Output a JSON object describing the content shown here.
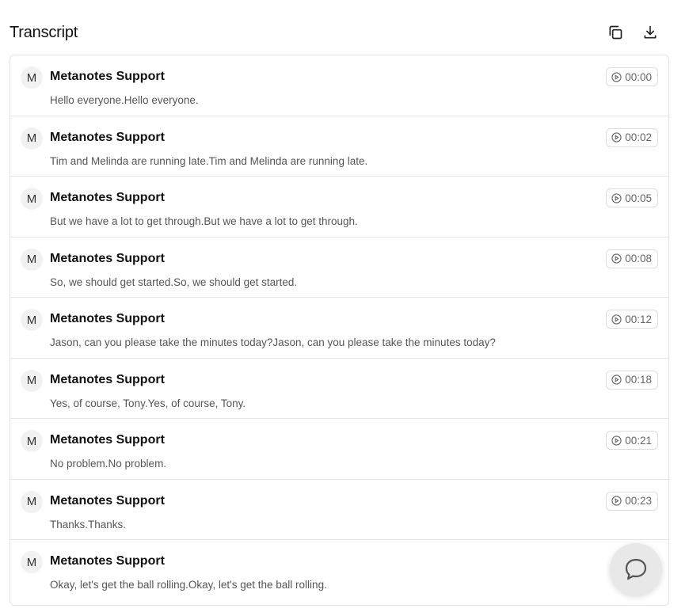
{
  "header": {
    "title": "Transcript",
    "copy_icon": "copy-icon",
    "download_icon": "download-icon"
  },
  "entries": [
    {
      "avatar": "M",
      "speaker": "Metanotes Support",
      "time": "00:00",
      "text": "Hello everyone.Hello everyone."
    },
    {
      "avatar": "M",
      "speaker": "Metanotes Support",
      "time": "00:02",
      "text": "Tim and Melinda are running late.Tim and Melinda are running late."
    },
    {
      "avatar": "M",
      "speaker": "Metanotes Support",
      "time": "00:05",
      "text": "But we have a lot to get through.But we have a lot to get through."
    },
    {
      "avatar": "M",
      "speaker": "Metanotes Support",
      "time": "00:08",
      "text": "So, we should get started.So, we should get started."
    },
    {
      "avatar": "M",
      "speaker": "Metanotes Support",
      "time": "00:12",
      "text": "Jason, can you please take the minutes today?Jason, can you please take the minutes today?"
    },
    {
      "avatar": "M",
      "speaker": "Metanotes Support",
      "time": "00:18",
      "text": "Yes, of course, Tony.Yes, of course, Tony."
    },
    {
      "avatar": "M",
      "speaker": "Metanotes Support",
      "time": "00:21",
      "text": "No problem.No problem."
    },
    {
      "avatar": "M",
      "speaker": "Metanotes Support",
      "time": "00:23",
      "text": "Thanks.Thanks."
    },
    {
      "avatar": "M",
      "speaker": "Metanotes Support",
      "time": "",
      "text": "Okay, let's get the ball rolling.Okay, let's get the ball rolling."
    }
  ],
  "chat_widget": {
    "icon": "chat-bubble-icon"
  }
}
